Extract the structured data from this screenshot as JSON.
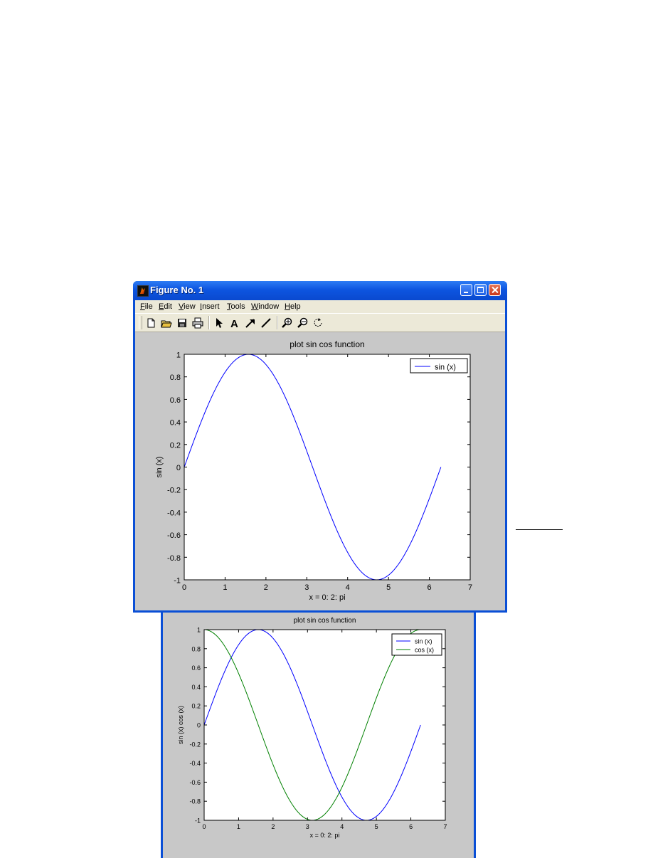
{
  "window": {
    "title": "Figure No. 1"
  },
  "menu": [
    "File",
    "Edit",
    "View",
    "Insert",
    "Tools",
    "Window",
    "Help"
  ],
  "toolbar": [
    "new-file-icon",
    "open-folder-icon",
    "save-icon",
    "print-icon",
    "arrow-pointer-icon",
    "text-tool-icon",
    "arrow-tool-icon",
    "line-tool-icon",
    "zoom-in-icon",
    "zoom-out-icon",
    "rotate-icon"
  ],
  "colors": {
    "sin": "#0000ff",
    "cos": "#008000",
    "titlebar": "#0a4fd6",
    "figure_bg": "#c8c8c8"
  },
  "chart_data": [
    {
      "type": "line",
      "title": "plot sin cos function",
      "xlabel": "x = 0: 2: pi",
      "ylabel": "sin (x)",
      "xlim": [
        0,
        7
      ],
      "ylim": [
        -1,
        1
      ],
      "xticks": [
        0,
        1,
        2,
        3,
        4,
        5,
        6,
        7
      ],
      "yticks": [
        -1,
        -0.8,
        -0.6,
        -0.4,
        -0.2,
        0,
        0.2,
        0.4,
        0.6,
        0.8,
        1
      ],
      "legend_position": "top-right",
      "grid": false,
      "series": [
        {
          "name": "sin (x)",
          "function": "sin",
          "x_range": [
            0,
            6.2832
          ],
          "color": "#0000ff"
        }
      ]
    },
    {
      "type": "line",
      "title": "plot sin cos function",
      "xlabel": "x = 0: 2: pi",
      "ylabel": "sin (x)  cos (x)",
      "xlim": [
        0,
        7
      ],
      "ylim": [
        -1,
        1
      ],
      "xticks": [
        0,
        1,
        2,
        3,
        4,
        5,
        6,
        7
      ],
      "yticks": [
        -1,
        -0.8,
        -0.6,
        -0.4,
        -0.2,
        0,
        0.2,
        0.4,
        0.6,
        0.8,
        1
      ],
      "legend_position": "top-right",
      "grid": false,
      "series": [
        {
          "name": "sin (x)",
          "function": "sin",
          "x_range": [
            0,
            6.2832
          ],
          "color": "#0000ff"
        },
        {
          "name": "cos (x)",
          "function": "cos",
          "x_range": [
            0,
            6.2832
          ],
          "color": "#008000"
        }
      ]
    }
  ]
}
